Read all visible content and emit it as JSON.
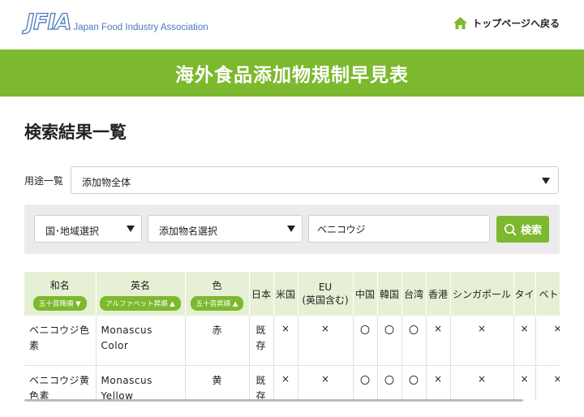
{
  "header": {
    "logo_mark": "JFIA",
    "logo_text": "Japan Food Industry Association",
    "top_link": "トップページへ戻る"
  },
  "banner": {
    "title": "海外食品添加物規制早見表"
  },
  "page_title": "検索結果一覧",
  "usage": {
    "label": "用途一覧",
    "value": "添加物全体"
  },
  "filters": {
    "region": "国･地域選択",
    "additive": "添加物名選択",
    "search_value": "ベニコウジ",
    "search_button": "検索"
  },
  "table": {
    "headers": {
      "jp_name": "和名",
      "jp_sort": "五十音降順 ▼",
      "en_name": "英名",
      "en_sort": "アルファベット昇順 ▲",
      "color": "色",
      "color_sort": "五十音昇順 ▲",
      "japan": "日本",
      "usa": "米国",
      "eu": "EU",
      "eu_note": "(英国含む)",
      "china": "中国",
      "korea": "韓国",
      "taiwan": "台湾",
      "hongkong": "香港",
      "singapore": "シンガポール",
      "thailand": "タイ",
      "vietnam": "ベトナ"
    },
    "rows": [
      {
        "jp_name": "ベニコウジ色素",
        "en_name": "Monascus Color",
        "color": "赤",
        "japan": "既存",
        "usa": "×",
        "eu": "×",
        "china": "〇",
        "korea": "〇",
        "taiwan": "〇",
        "hongkong": "×",
        "singapore": "×",
        "thailand": "×",
        "vietnam": "×"
      },
      {
        "jp_name": "ベニコウジ黄色素",
        "en_name": "Monascus Yellow",
        "color": "黄",
        "japan": "既存",
        "usa": "×",
        "eu": "×",
        "china": "〇",
        "korea": "〇",
        "taiwan": "〇",
        "hongkong": "×",
        "singapore": "×",
        "thailand": "×",
        "vietnam": "×"
      }
    ]
  },
  "colors": {
    "accent": "#7db92e",
    "header_cell": "#e6f0d5",
    "logo": "#4a7bbd"
  },
  "icons": {
    "home": "home-icon",
    "search": "search-icon",
    "dropdown": "caret-down-icon"
  }
}
